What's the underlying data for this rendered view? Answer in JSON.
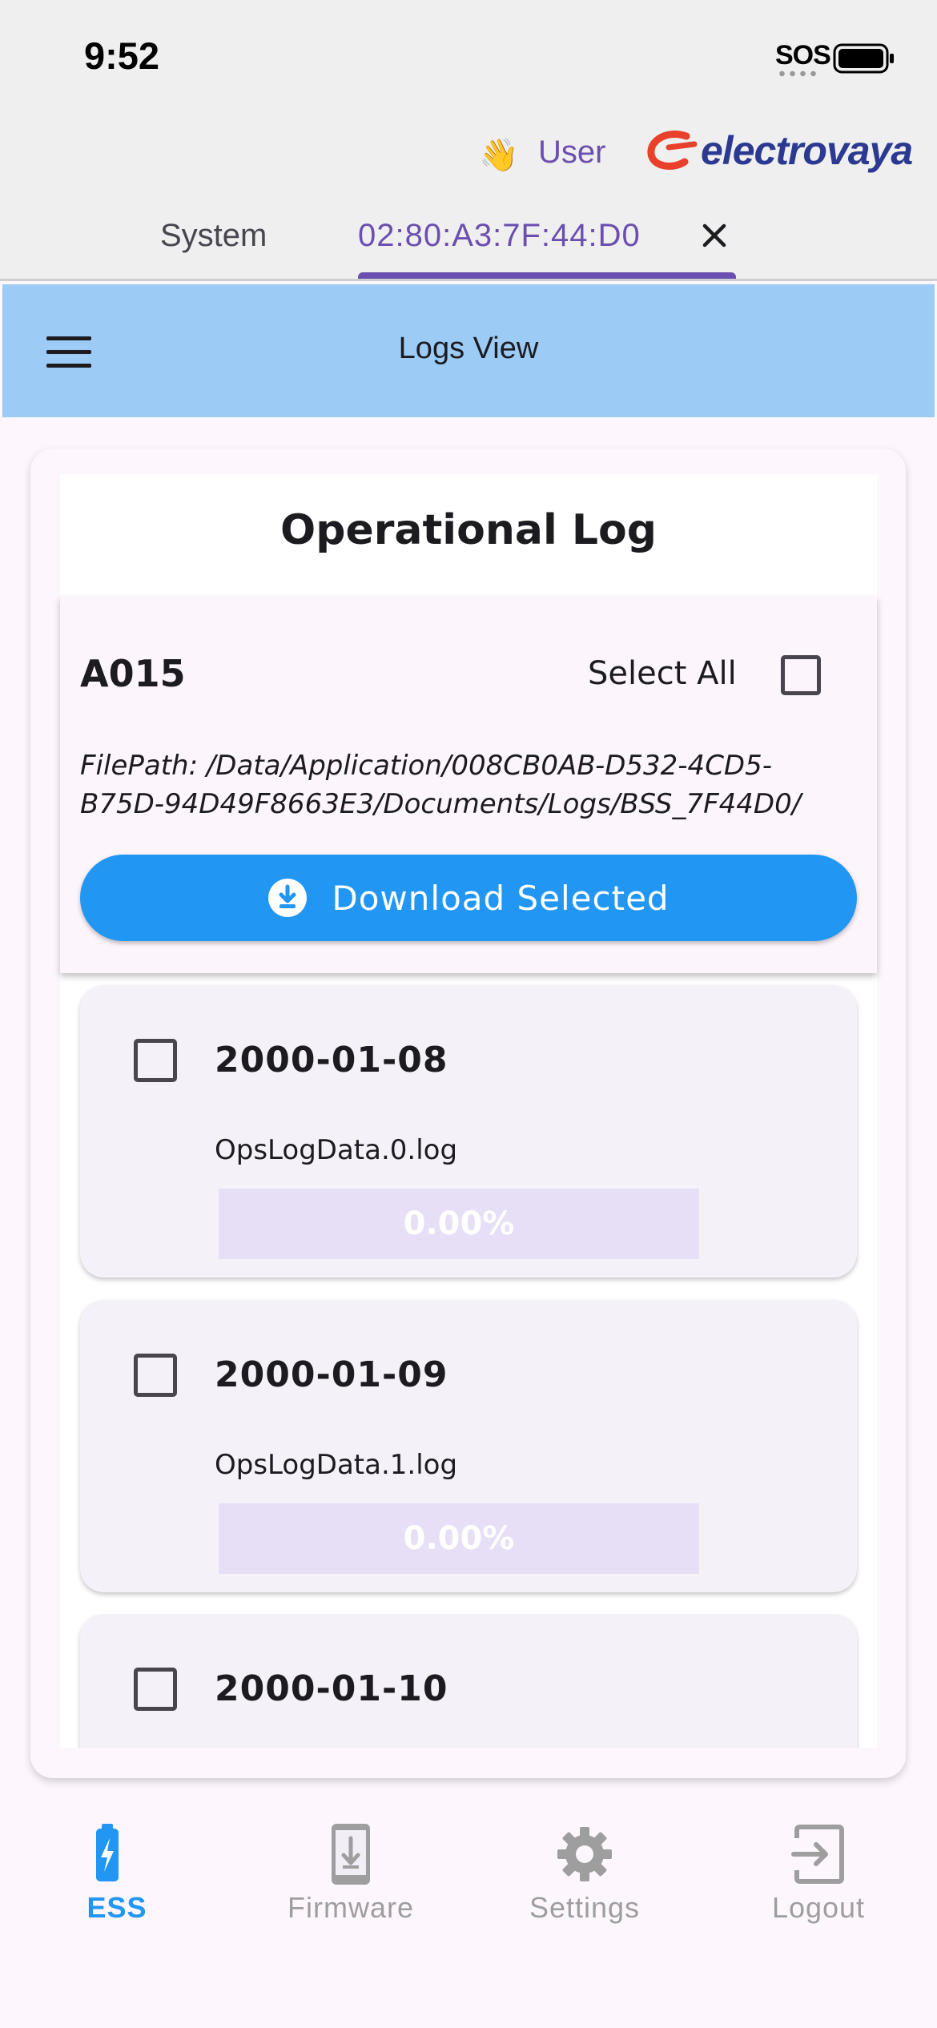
{
  "status_bar": {
    "time": "9:52",
    "signal_text": "SOS"
  },
  "header": {
    "wave_emoji": "👋",
    "user_label": "User",
    "logo_text": "electrovaya",
    "brand_color": "#2b3990",
    "accent_color": "#6b4fb0"
  },
  "tabs": [
    {
      "label": "System",
      "active": false
    },
    {
      "label": "02:80:A3:7F:44:D0",
      "active": true,
      "closable": true
    }
  ],
  "app_bar": {
    "title": "Logs View",
    "menu_icon": "hamburger-icon",
    "color": "#9ccbf5"
  },
  "log_panel": {
    "title": "Operational Log",
    "device_id": "A015",
    "select_all_label": "Select All",
    "select_all_checked": false,
    "file_path": "FilePath: /Data/Application/008CB0AB-D532-4CD5-B75D-94D49F8663E3/Documents/Logs/BSS_7F44D0/",
    "download_label": "Download Selected",
    "download_color": "#2196f3"
  },
  "logs": [
    {
      "date": "2000-01-08",
      "file": "OpsLogData.0.log",
      "progress": "0.00%",
      "checked": false
    },
    {
      "date": "2000-01-09",
      "file": "OpsLogData.1.log",
      "progress": "0.00%",
      "checked": false
    },
    {
      "date": "2000-01-10",
      "file": "",
      "progress": "",
      "checked": false
    }
  ],
  "bottom_nav": [
    {
      "label": "ESS",
      "icon": "battery-bolt-icon",
      "active": true
    },
    {
      "label": "Firmware",
      "icon": "phone-download-icon",
      "active": false
    },
    {
      "label": "Settings",
      "icon": "gear-icon",
      "active": false
    },
    {
      "label": "Logout",
      "icon": "logout-icon",
      "active": false
    }
  ]
}
